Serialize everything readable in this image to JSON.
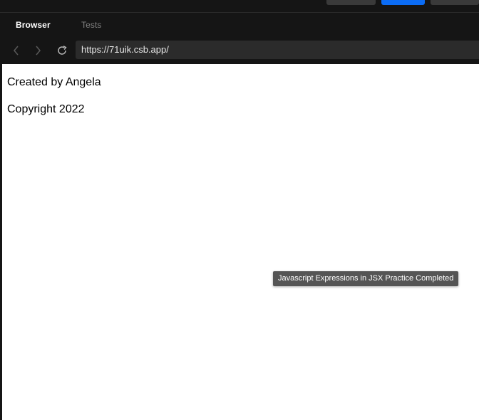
{
  "tabs": [
    {
      "label": "Browser",
      "active": true
    },
    {
      "label": "Tests",
      "active": false
    }
  ],
  "nav": {
    "back_icon": "chevron-left-icon",
    "forward_icon": "chevron-right-icon",
    "reload_icon": "reload-icon",
    "url": "https://71uik.csb.app/"
  },
  "page": {
    "line1": "Created by Angela",
    "line2": "Copyright 2022"
  },
  "tooltip": "Javascript Expressions in JSX Practice Completed",
  "colors": {
    "accent": "#0b6cf5",
    "chrome_bg": "#151515",
    "url_bg": "#2b2b2b"
  }
}
